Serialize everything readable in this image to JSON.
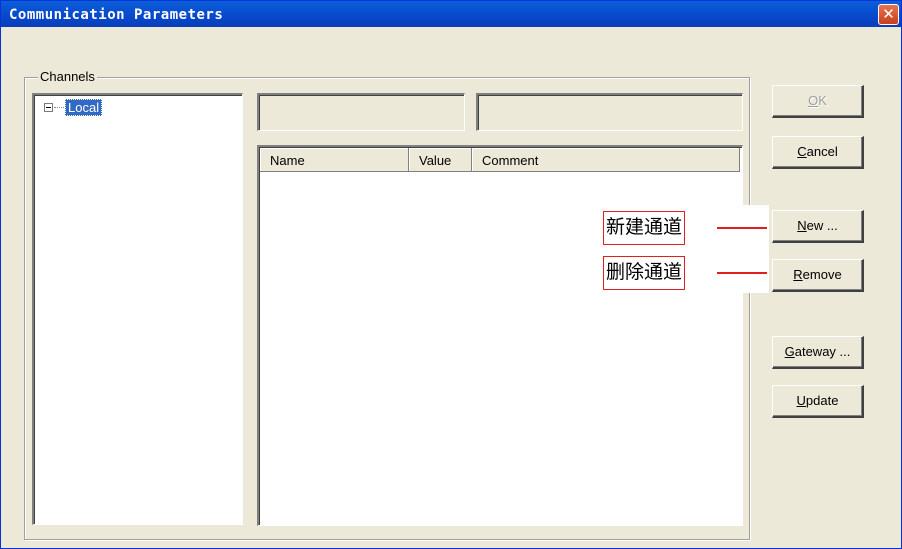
{
  "window": {
    "title": "Communication Parameters",
    "close_glyph": "✕"
  },
  "channels": {
    "label": "Channels",
    "tree": [
      {
        "label": "Local",
        "expanded": true,
        "selected": true
      }
    ]
  },
  "list": {
    "columns": [
      "Name",
      "Value",
      "Comment"
    ],
    "rows": []
  },
  "buttons": {
    "ok": {
      "mnemonic": "O",
      "rest": "K",
      "enabled": false
    },
    "cancel": {
      "mnemonic": "C",
      "rest": "ancel"
    },
    "new": {
      "mnemonic": "N",
      "rest": "ew ..."
    },
    "remove": {
      "mnemonic": "R",
      "rest": "emove"
    },
    "gateway": {
      "mnemonic": "G",
      "rest": "ateway ..."
    },
    "update": {
      "mnemonic": "U",
      "rest": "pdate"
    }
  },
  "annotations": {
    "new_channel": "新建通道",
    "delete_channel": "删除通道"
  },
  "colors": {
    "title_bar": "#0a4fd0",
    "dialog_bg": "#ece9d8",
    "selection": "#316ac5",
    "annotation": "#e02020"
  }
}
